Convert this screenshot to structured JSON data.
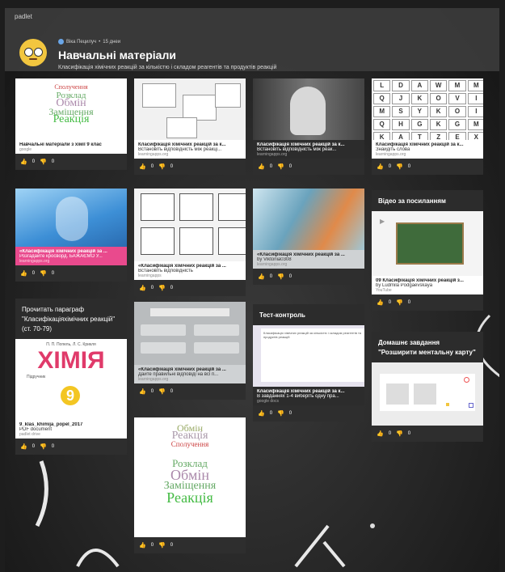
{
  "app": {
    "brand": "padlet"
  },
  "header": {
    "author": "Віка Пецилуч",
    "time": "15 днеи",
    "title": "Навчальні матеріали",
    "subtitle": "Класифікація хімічних реакцій за кількістю і складом реагентів та продуктів реакцій"
  },
  "cards": [
    {
      "title": "Навчальні матеріали з хімії 9 клас",
      "desc": "",
      "source": "google",
      "likes": "0",
      "dislikes": "0"
    },
    {
      "title": "Класифікація хімічних реакцій за к...",
      "desc": "Встановіть відповідність між реакці...",
      "source": "learningapps.org",
      "likes": "0",
      "dislikes": "0"
    },
    {
      "title": "Класифікація хімічних реакцій за к...",
      "desc": "Встановіть відповідність між реак...",
      "source": "learningapps.org",
      "likes": "0",
      "dislikes": "0"
    },
    {
      "title": "Класифікація хімічних реакцій за к...",
      "desc": "Знайдіть слова",
      "source": "learningapps.org",
      "likes": "0",
      "dislikes": "0"
    },
    {
      "title": "«Класифікація хімічних реакцій за ...",
      "desc": "Розгадайте кросворд. БАЖАЄМО У...",
      "source": "learningapps.org",
      "likes": "0",
      "dislikes": "0"
    },
    {
      "title": "«Класифікація хімічних реакцій за ...",
      "desc": "Встановіть відповідність",
      "source": "learningapps",
      "likes": "0",
      "dislikes": "0"
    },
    {
      "title": "«Класифікація хімічних реакцій за ...",
      "desc": "by Viktoriia0308",
      "source": "learningapps.org",
      "likes": "0",
      "dislikes": "0"
    },
    {
      "head": "Відео за посиланням",
      "title": "09 Класифікація хімічних реакцій з...",
      "desc": "by Ludmila Podgaevskaya",
      "source": "YouTube",
      "likes": "0",
      "dislikes": "0"
    },
    {
      "head": "Прочитать параграф \"Класифікаціяхімічних реакцій\" (ст. 70-79)",
      "title": "9_klas_khimija_popel_2017",
      "desc": "PDF document",
      "source": "padlet drive",
      "likes": "0",
      "dislikes": "0",
      "book_authors": "П. П. Попель, Л. С. Крикля",
      "book_title": "ХІМІЯ",
      "book_grade": "9",
      "book_sub": "Підручник"
    },
    {
      "title": "«Класифікація хімічних реакцій за ...",
      "desc": "Дайте правильні відповіді на всі п...",
      "source": "learningapps.org",
      "likes": "0",
      "dislikes": "0"
    },
    {
      "head": "Тест-контроль",
      "title": "Класифікація хімічних реакцій за к...",
      "desc": "В завданнях 1-4 виберіть одну пра...",
      "source": "google docs",
      "likes": "0",
      "dislikes": "0",
      "doc_text": "Класифікація хімічних реакцій за кількістю і складом реагентів та продуктів реакцій"
    },
    {
      "head": "Домашнє завдання \"Розширити ментальну карту\"",
      "likes": "0",
      "dislikes": "0"
    },
    {
      "likes": "0",
      "dislikes": "0"
    }
  ],
  "wordcloud": {
    "w1": "Розклад",
    "w2": "Обмін",
    "w3": "Заміщення",
    "w4": "Реакція",
    "w5": "Сполучення"
  },
  "letters": [
    "L",
    "D",
    "A",
    "W",
    "M",
    "M",
    "Q",
    "J",
    "K",
    "O",
    "V",
    "I",
    "M",
    "S",
    "Y",
    "K",
    "O",
    "I",
    "Q",
    "H",
    "G",
    "K",
    "G",
    "M",
    "K",
    "A",
    "T",
    "Z",
    "E",
    "X"
  ],
  "icons": {
    "like": "thumbs-up-icon",
    "dislike": "thumbs-down-icon",
    "author": "user-dot-icon"
  },
  "colors": {
    "accent_pink": "#e94a8d",
    "chemistry_red": "#e03a6a"
  }
}
